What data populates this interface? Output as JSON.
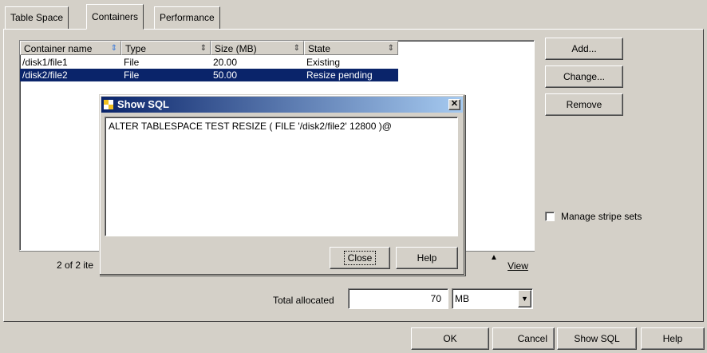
{
  "tabs": [
    {
      "label": "Table Space"
    },
    {
      "label": "Containers"
    },
    {
      "label": "Performance"
    }
  ],
  "table": {
    "columns": [
      "Container name",
      "Type",
      "Size (MB)",
      "State"
    ],
    "rows": [
      {
        "name": "/disk1/file1",
        "type": "File",
        "size": "20.00",
        "state": "Existing"
      },
      {
        "name": "/disk2/file2",
        "type": "File",
        "size": "50.00",
        "state": "Resize pending"
      }
    ],
    "status": "2 of 2 ite"
  },
  "side_buttons": {
    "add": "Add...",
    "change": "Change...",
    "remove": "Remove"
  },
  "manage_stripe_sets": "Manage stripe sets",
  "view_label": "View",
  "total": {
    "label": "Total allocated",
    "value": "70",
    "unit": "MB"
  },
  "dialog": {
    "title": "Show SQL",
    "sql": "ALTER TABLESPACE TEST RESIZE ( FILE '/disk2/file2' 12800 )@",
    "close": "Close",
    "help": "Help"
  },
  "footer": {
    "ok": "OK",
    "cancel": "Cancel",
    "show_sql": "Show SQL",
    "help": "Help"
  }
}
